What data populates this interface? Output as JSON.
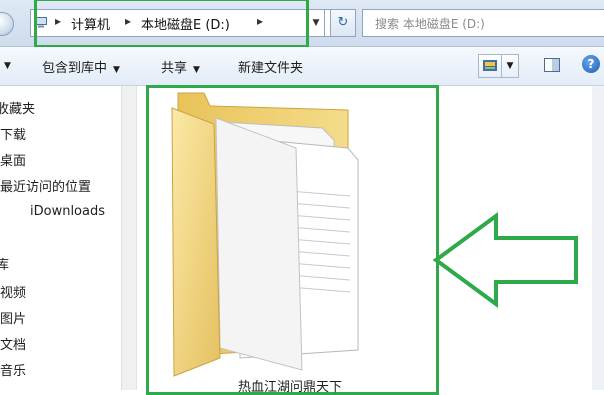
{
  "address_bar": {
    "breadcrumbs": [
      "计算机",
      "本地磁盘E (D:)"
    ],
    "separator": "▸"
  },
  "search": {
    "placeholder": "搜索 本地磁盘E (D:)"
  },
  "toolbar": {
    "include_library": "包含到库中",
    "share": "共享",
    "new_folder": "新建文件夹"
  },
  "sidebar": {
    "items": [
      {
        "label": "收藏夹"
      },
      {
        "label": "下载"
      },
      {
        "label": "桌面"
      },
      {
        "label": "最近访问的位置"
      },
      {
        "label": "iDownloads"
      },
      {
        "label": "库"
      },
      {
        "label": "视频"
      },
      {
        "label": "图片"
      },
      {
        "label": "文档"
      },
      {
        "label": "音乐"
      }
    ]
  },
  "content": {
    "folder_name": "热血江湖问鼎天下"
  },
  "colors": {
    "highlight": "#2eaa4a",
    "folder": "#f3d77a"
  }
}
